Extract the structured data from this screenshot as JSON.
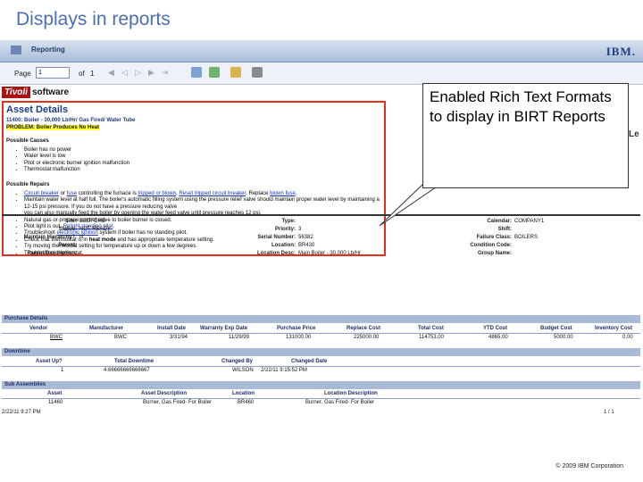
{
  "slide": {
    "title": "Displays in reports",
    "footer": "© 2009 IBM Corporation"
  },
  "header": {
    "app_title": "Reporting",
    "logo": "IBM."
  },
  "toolbar": {
    "page_label": "Page",
    "page_value": "1",
    "of_label": "of",
    "of_value": "1"
  },
  "brand": {
    "tivoli": "Tivoli",
    "software": "software"
  },
  "asset": {
    "title": "Asset Details",
    "line1": "11400: Boiler - 30,000 Lb/Hr/ Gas Fired/ Water Tube",
    "problem": "PROBLEM: Boiler Produces No Heat",
    "causes_title": "Possible Causes",
    "causes": [
      "Boiler has no power",
      "Water level is low",
      "Pilot or electronic burner ignition malfunction",
      "Thermostat malfunction"
    ],
    "repairs_title": "Possible Repairs",
    "repairs": [
      {
        "pre": "",
        "l1": "Circuit breaker",
        "mid1": " or ",
        "l2": "fuse",
        "mid2": " controlling the furnace is ",
        "l3": "tripped or blown",
        "mid3": ". ",
        "l4": "Reset tripped circuit breaker",
        "mid4": ". Replace ",
        "l5": "blown fuse",
        "post": "."
      },
      {
        "pre": "Maintain water level at half full. The boiler's automatic filling system using the pressure relief valve should maintain proper water level by maintaining a 12-15 psi pressure. If you do not have a pressure reducing valve",
        "l1": "",
        "mid1": "",
        "l2": "",
        "mid2": "",
        "l3": "",
        "mid3": "",
        "l4": "",
        "mid4": "",
        "l5": "",
        "post": ""
      },
      {
        "pre": "you can also manually feed the boiler by opening the water feed valve until pressure reaches 12 psi.",
        "l1": "",
        "mid1": "",
        "l2": "",
        "mid2": "",
        "l3": "",
        "mid3": "",
        "l4": "",
        "mid4": "",
        "l5": "",
        "post": ""
      },
      {
        "pre": "Natural gas or propane control valve to boiler burner is closed.",
        "l1": "",
        "mid1": "",
        "l2": "",
        "mid2": "",
        "l3": "",
        "mid3": "",
        "l4": "",
        "mid4": "",
        "l5": "",
        "post": ""
      },
      {
        "pre": "Pilot light is out. ",
        "l1": "Relight standing pilot",
        "mid1": ".",
        "l2": "",
        "mid2": "",
        "l3": "",
        "mid3": "",
        "l4": "",
        "mid4": "",
        "l5": "",
        "post": ""
      },
      {
        "pre": "Troubleshoot ",
        "l1": "electronic ignition",
        "mid1": " system if boiler has no standing pilot.",
        "l2": "",
        "mid2": "",
        "l3": "",
        "mid3": "",
        "l4": "",
        "mid4": "",
        "l5": "",
        "post": ""
      },
      {
        "pre": "Check that thermostat is in ",
        "l1": "",
        "mid1": "",
        "l2": "",
        "mid2": "",
        "l3": "",
        "mid3": "",
        "l4": "",
        "mid4": "",
        "l5": "",
        "post": "",
        "bold": "heat mode",
        "tail": " and has appropriate temperature setting."
      },
      {
        "pre": "Try moving thermostat setting for temperature up or down a few degrees.",
        "l1": "",
        "mid1": "",
        "l2": "",
        "mid2": "",
        "l3": "",
        "mid3": "",
        "l4": "",
        "mid4": "",
        "l5": "",
        "post": ""
      },
      {
        "pre": "Troubleshoot thermostat.",
        "l1": "",
        "mid1": "",
        "l2": "",
        "mid2": "",
        "l3": "",
        "mid3": "",
        "l4": "",
        "mid4": "",
        "l5": "",
        "post": ""
      }
    ]
  },
  "callout": {
    "text": "Enabled Rich Text Formats to display in BIRT Reports"
  },
  "right_glyph": "Le",
  "fields": {
    "site_label": "Site:",
    "site": "BEDFORD",
    "status_label": "Status:",
    "status": "NOT READY",
    "hier_label": "Maintain Hierarchy?:",
    "hier": "N",
    "parent_label": "Parent:",
    "parent": "",
    "pdesc_label": "Parent Description:",
    "pdesc": "",
    "type_label": "Type:",
    "type": "",
    "priority_label": "Priority:",
    "priority": "3",
    "serial_label": "Serial Number:",
    "serial": "56382",
    "location_label": "Location:",
    "location": "BR430",
    "locdesc_label": "Location Desc:",
    "locdesc": "Main Boiler - 30,000 Lb/Hr",
    "calendar_label": "Calendar:",
    "calendar": "COMPANY1",
    "shift_label": "Shift:",
    "shift": "",
    "failure_label": "Failure Class:",
    "failure": "BOILERS",
    "condition_label": "Condition Code:",
    "condition": "",
    "group_label": "Group Name:",
    "group": ""
  },
  "purchase": {
    "title": "Purchase Details",
    "headers": [
      "Vendor",
      "Manufacturer",
      "Install Date",
      "Warranty Exp Date",
      "Purchase Price",
      "Replace Cost",
      "Total Cost",
      "YTD Cost",
      "Budget Cost",
      "Inventory Cost"
    ],
    "row": [
      "BWC",
      "BWC",
      "3/31/94",
      "11/29/99",
      "131000.00",
      "225000.00",
      "114753.00",
      "4865.00",
      "5000.00",
      "0.00"
    ]
  },
  "downtime": {
    "title": "Downtime",
    "headers": [
      "Asset Up?",
      "Total Downtime",
      "Changed By",
      "Changed Date"
    ],
    "row": [
      "1",
      "4.66666666666667",
      "WILSON",
      "2/22/11 9:15:52 PM"
    ]
  },
  "subassemblies": {
    "title": "Sub Assemblies",
    "headers": [
      "Asset",
      "Asset Description",
      "Location",
      "Location Description"
    ],
    "row": [
      "11460",
      "Burner, Gas Fired- For Boiler",
      "BR460",
      "Burner, Gas Fired- For Boiler"
    ]
  },
  "report_footer": {
    "timestamp": "2/22/11 9:27 PM",
    "pages": "1 / 1"
  }
}
